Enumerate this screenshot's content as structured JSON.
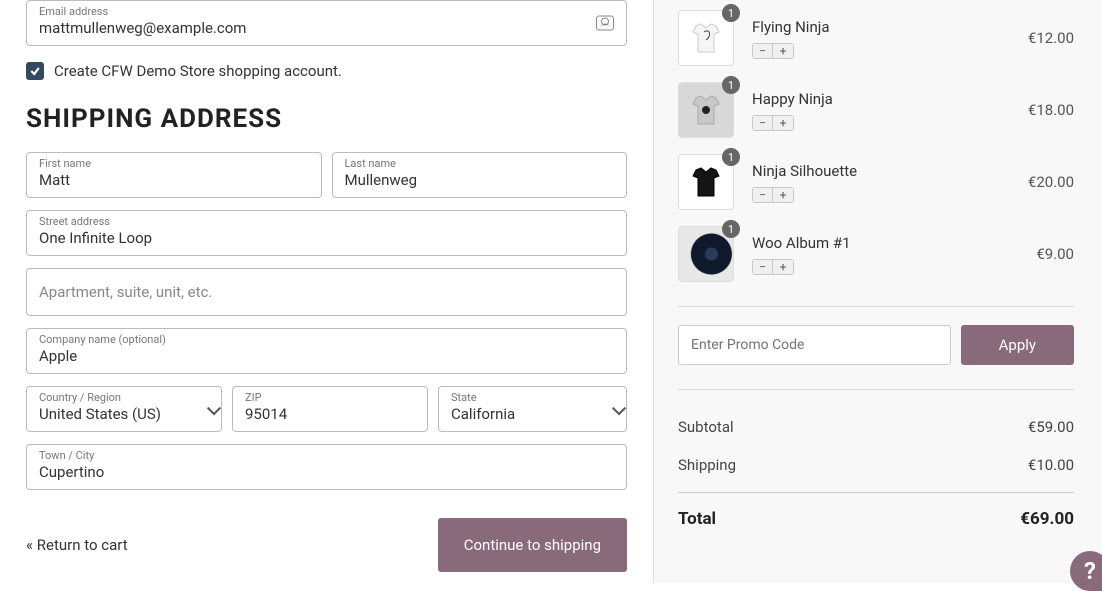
{
  "email": {
    "label": "Email address",
    "value": "mattmullenweg@example.com"
  },
  "create_account_label": "Create CFW Demo Store shopping account.",
  "shipping_title": "SHIPPING ADDRESS",
  "first_name": {
    "label": "First name",
    "value": "Matt"
  },
  "last_name": {
    "label": "Last name",
    "value": "Mullenweg"
  },
  "street": {
    "label": "Street address",
    "value": "One Infinite Loop"
  },
  "apartment": {
    "placeholder": "Apartment, suite, unit, etc."
  },
  "company": {
    "label": "Company name (optional)",
    "value": "Apple"
  },
  "country": {
    "label": "Country / Region",
    "value": "United States (US)"
  },
  "zip": {
    "label": "ZIP",
    "value": "95014"
  },
  "state": {
    "label": "State",
    "value": "California"
  },
  "city": {
    "label": "Town / City",
    "value": "Cupertino"
  },
  "return_link": "« Return to cart",
  "continue_label": "Continue to shipping",
  "cart": {
    "items": [
      {
        "qty": "1",
        "name": "Flying Ninja",
        "price": "€12.00"
      },
      {
        "qty": "1",
        "name": "Happy Ninja",
        "price": "€18.00"
      },
      {
        "qty": "1",
        "name": "Ninja Silhouette",
        "price": "€20.00"
      },
      {
        "qty": "1",
        "name": "Woo Album #1",
        "price": "€9.00"
      }
    ]
  },
  "promo": {
    "placeholder": "Enter Promo Code",
    "apply": "Apply"
  },
  "totals": {
    "subtotal_label": "Subtotal",
    "subtotal": "€59.00",
    "shipping_label": "Shipping",
    "shipping": "€10.00",
    "total_label": "Total",
    "total": "€69.00"
  },
  "help_icon": "?"
}
